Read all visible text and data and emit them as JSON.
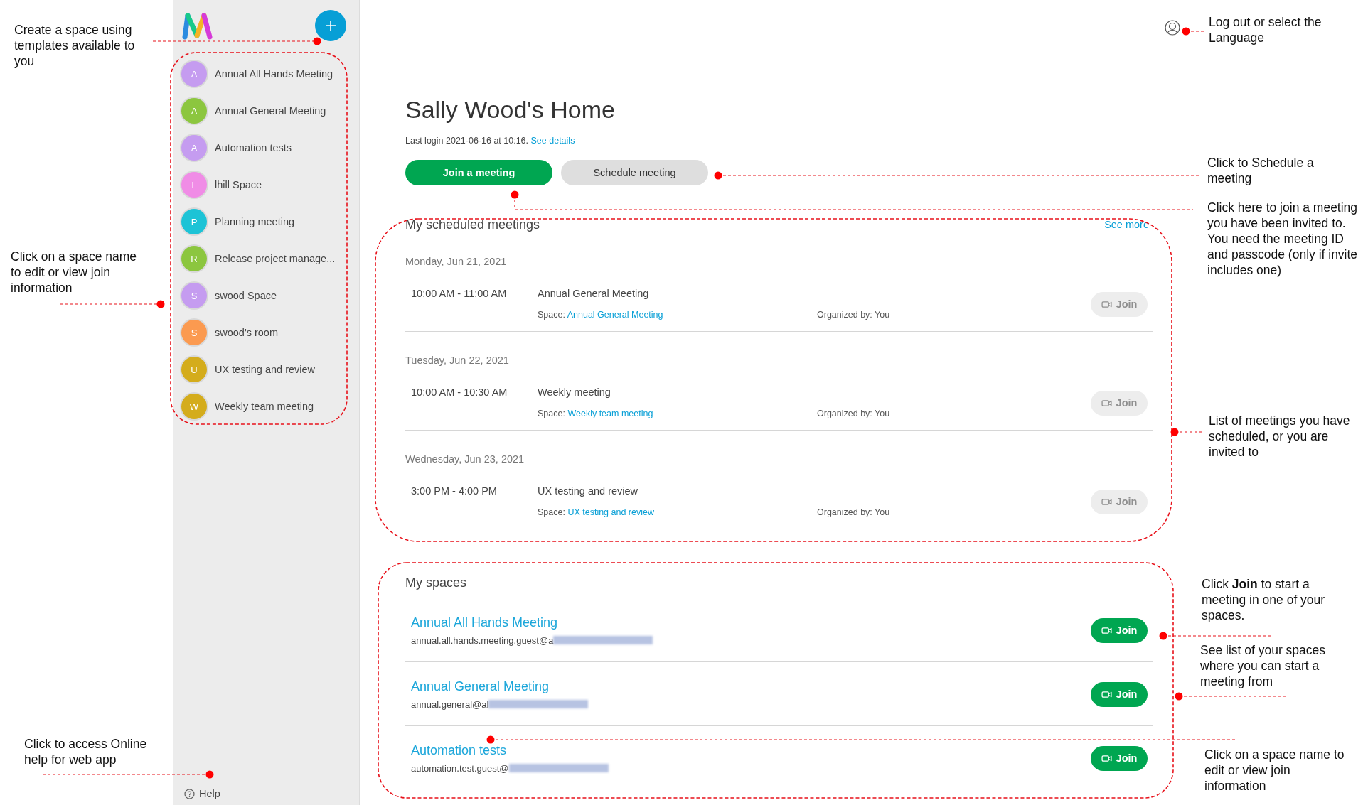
{
  "sidebar": {
    "items": [
      {
        "initial": "A",
        "name": "Annual All Hands Meeting",
        "color": "#c59cf0"
      },
      {
        "initial": "A",
        "name": "Annual General Meeting",
        "color": "#8cc63f"
      },
      {
        "initial": "A",
        "name": "Automation tests",
        "color": "#c59cf0"
      },
      {
        "initial": "L",
        "name": "lhill Space",
        "color": "#f08ce6"
      },
      {
        "initial": "P",
        "name": "Planning meeting",
        "color": "#1dc3d6"
      },
      {
        "initial": "R",
        "name": "Release project manage...",
        "color": "#8cc63f"
      },
      {
        "initial": "S",
        "name": "swood Space",
        "color": "#c59cf0"
      },
      {
        "initial": "S",
        "name": "swood's room",
        "color": "#fb9a50"
      },
      {
        "initial": "U",
        "name": "UX testing and review",
        "color": "#d4ac1c"
      },
      {
        "initial": "W",
        "name": "Weekly team meeting",
        "color": "#d4ac1c"
      }
    ],
    "help": "Help"
  },
  "home": {
    "title": "Sally Wood's Home",
    "last_login": "Last login 2021-06-16 at 10:16.",
    "see_details": "See details",
    "buttons": [
      {
        "label": "Join a meeting",
        "kind": "primary"
      },
      {
        "label": "Schedule meeting",
        "kind": "secondary"
      }
    ]
  },
  "scheduled": {
    "title": "My scheduled meetings",
    "see_more": "See more",
    "days": [
      {
        "date": "Monday, Jun 21, 2021",
        "meetings": [
          {
            "time": "10:00 AM - 11:00 AM",
            "title": "Annual General Meeting",
            "space_label": "Space:",
            "space": "Annual General Meeting",
            "organizer": "Organized by: You",
            "join": "Join",
            "disabled": true
          }
        ]
      },
      {
        "date": "Tuesday, Jun 22, 2021",
        "meetings": [
          {
            "time": "10:00 AM - 10:30 AM",
            "title": "Weekly meeting",
            "space_label": "Space:",
            "space": "Weekly team meeting",
            "organizer": "Organized by: You",
            "join": "Join",
            "disabled": true
          }
        ]
      },
      {
        "date": "Wednesday, Jun 23, 2021",
        "meetings": [
          {
            "time": "3:00 PM - 4:00 PM",
            "title": "UX testing and review",
            "space_label": "Space:",
            "space": "UX testing and review",
            "organizer": "Organized by: You",
            "join": "Join",
            "disabled": true
          }
        ]
      }
    ]
  },
  "spaces": {
    "title": "My spaces",
    "items": [
      {
        "name": "Annual All Hands Meeting",
        "address": "annual.all.hands.meeting.guest@a",
        "join": "Join",
        "disabled": false
      },
      {
        "name": "Annual General Meeting",
        "address": "annual.general@al",
        "join": "Join",
        "disabled": false
      },
      {
        "name": "Automation tests",
        "address": "automation.test.guest@",
        "join": "Join",
        "disabled": false
      }
    ]
  },
  "annotations": [
    {
      "text": "Create a space using templates available to you"
    },
    {
      "text": "Click on a space name to edit or view join information"
    },
    {
      "text": "Click to access Online help for web app"
    },
    {
      "text": "Log out or select the Language"
    },
    {
      "text": "Click to Schedule a meeting"
    },
    {
      "text": "Click here to join a meeting you have been invited to. You need the meeting ID and passcode (only if invite includes one)"
    },
    {
      "text": "List of meetings you have scheduled, or you are invited to"
    },
    {
      "text": "Click **Join** to start a meeting in one of your spaces."
    },
    {
      "text": "See list of your spaces where you can start a meeting from"
    },
    {
      "text": "Click on a space name to edit or view join information"
    }
  ]
}
